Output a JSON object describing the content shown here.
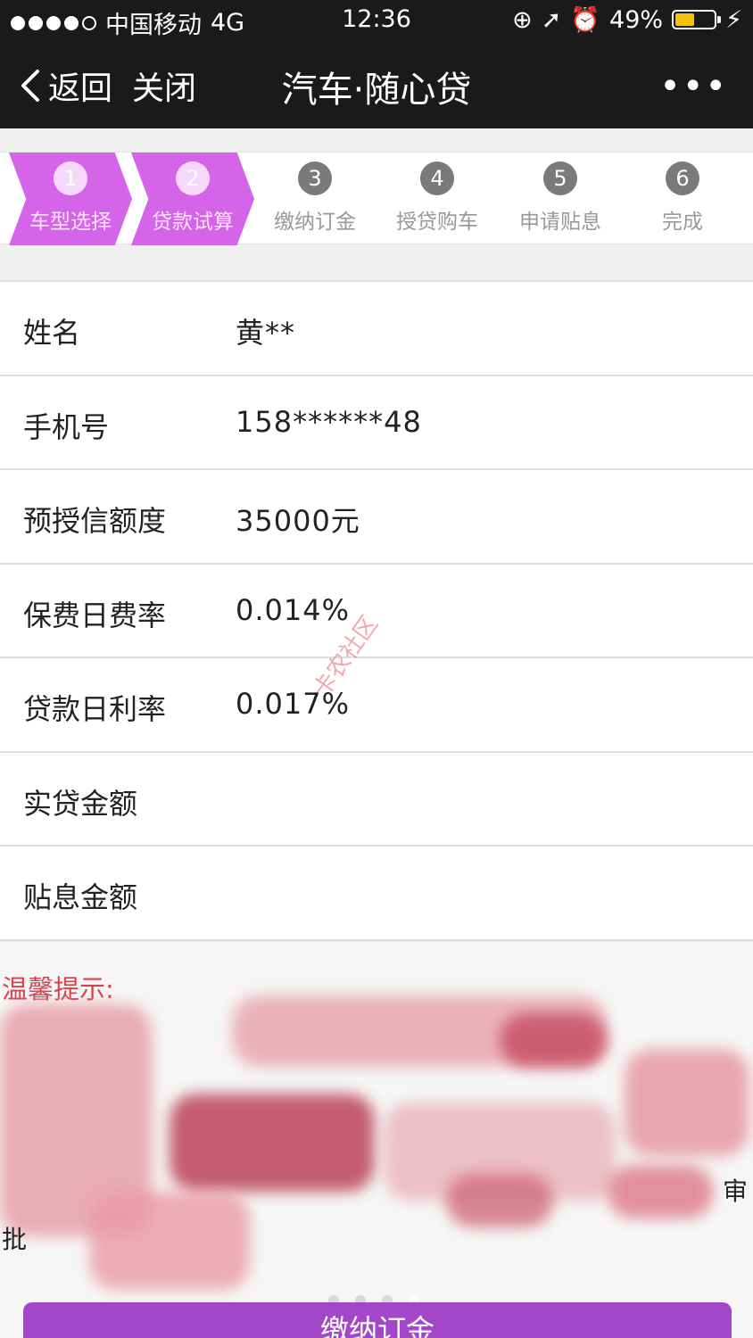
{
  "status_bar": {
    "carrier": "中国移动",
    "network": "4G",
    "time": "12:36",
    "battery_percent": "49%",
    "battery_level": 0.49,
    "icons": [
      "signal-dots-icon",
      "rotation-lock-icon",
      "location-icon",
      "alarm-icon",
      "battery-icon",
      "charging-icon"
    ]
  },
  "nav": {
    "back_label": "返回",
    "close_label": "关闭",
    "title": "汽车·随心贷",
    "more_label": "•••"
  },
  "steps": [
    {
      "num": "1",
      "label": "车型选择",
      "active": true
    },
    {
      "num": "2",
      "label": "贷款试算",
      "active": true
    },
    {
      "num": "3",
      "label": "缴纳订金",
      "active": false
    },
    {
      "num": "4",
      "label": "授贷购车",
      "active": false
    },
    {
      "num": "5",
      "label": "申请贴息",
      "active": false
    },
    {
      "num": "6",
      "label": "完成",
      "active": false
    }
  ],
  "info": {
    "name_label": "姓名",
    "name_value": "黄**",
    "phone_label": "手机号",
    "phone_value": "158******48",
    "credit_label": "预授信额度",
    "credit_value": "35000元",
    "insurance_rate_label": "保费日费率",
    "insurance_rate_value": "0.014%",
    "loan_rate_label": "贷款日利率",
    "loan_rate_value": "0.017%",
    "actual_loan_label": "实贷金额",
    "actual_loan_value": "",
    "subsidy_label": "贴息金额",
    "subsidy_value": ""
  },
  "notice": {
    "title": "温馨提示:",
    "tail_left": "批",
    "tail_right": "审"
  },
  "pager": {
    "count": 4,
    "active_index": 3
  },
  "watermark": "卡农社区",
  "button": {
    "label": "缴纳订金"
  },
  "colors": {
    "accent": "#a347c9",
    "step_active": "#d464e8",
    "notice_red": "#d9424c",
    "battery": "#f4c20d"
  }
}
